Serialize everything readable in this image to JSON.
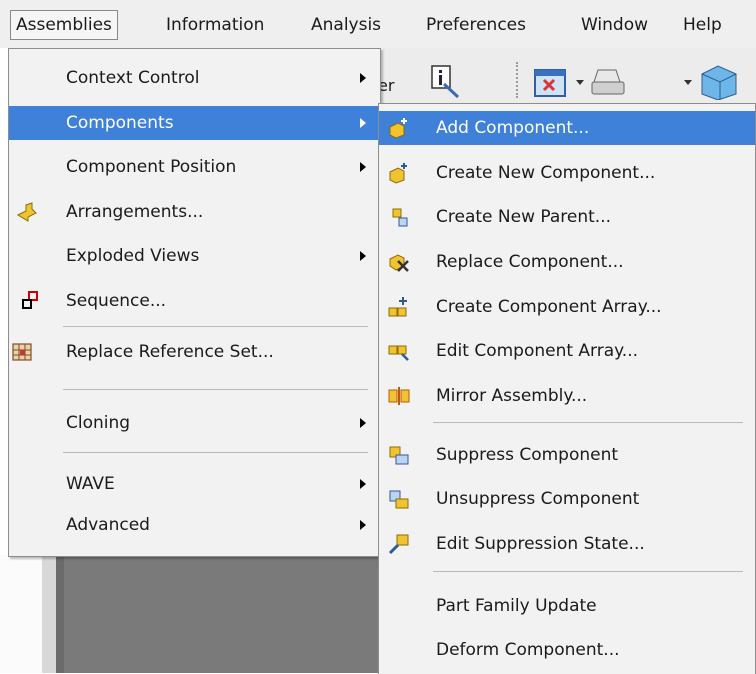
{
  "menubar": {
    "items": [
      {
        "label": "Assemblies",
        "active": true
      },
      {
        "label": "Information"
      },
      {
        "label": "Analysis"
      },
      {
        "label": "Preferences"
      },
      {
        "label": "Window"
      },
      {
        "label": "Help"
      }
    ]
  },
  "toolbar": {
    "partial_text": "er"
  },
  "assemblies_menu": {
    "items": [
      {
        "label": "Context Control",
        "submenu": true
      },
      {
        "label": "Components",
        "submenu": true,
        "highlighted": true
      },
      {
        "label": "Component Position",
        "submenu": true
      },
      {
        "label": "Arrangements...",
        "icon": "arrangements-icon"
      },
      {
        "label": "Exploded Views",
        "submenu": true
      },
      {
        "label": "Sequence...",
        "icon": "sequence-icon"
      },
      {
        "label": "Replace Reference Set...",
        "icon": "replace-reference-set-icon"
      },
      {
        "label": "Cloning",
        "submenu": true
      },
      {
        "label": "WAVE",
        "submenu": true
      },
      {
        "label": "Advanced",
        "submenu": true
      }
    ]
  },
  "components_submenu": {
    "items": [
      {
        "label": "Add Component...",
        "icon": "add-component-icon",
        "highlighted": true
      },
      {
        "label": "Create New Component...",
        "icon": "create-new-component-icon"
      },
      {
        "label": "Create New Parent...",
        "icon": "create-new-parent-icon"
      },
      {
        "label": "Replace Component...",
        "icon": "replace-component-icon"
      },
      {
        "label": "Create Component Array...",
        "icon": "create-component-array-icon"
      },
      {
        "label": "Edit Component Array...",
        "icon": "edit-component-array-icon"
      },
      {
        "label": "Mirror Assembly...",
        "icon": "mirror-assembly-icon"
      },
      {
        "label": "Suppress Component",
        "icon": "suppress-component-icon"
      },
      {
        "label": "Unsuppress Component",
        "icon": "unsuppress-component-icon"
      },
      {
        "label": "Edit Suppression State...",
        "icon": "edit-suppression-state-icon"
      },
      {
        "label": "Part Family Update"
      },
      {
        "label": "Deform Component..."
      }
    ]
  },
  "colors": {
    "highlight": "#3f80d8",
    "menu_bg": "#f2f2f2",
    "menubar_bg": "#efefef"
  }
}
